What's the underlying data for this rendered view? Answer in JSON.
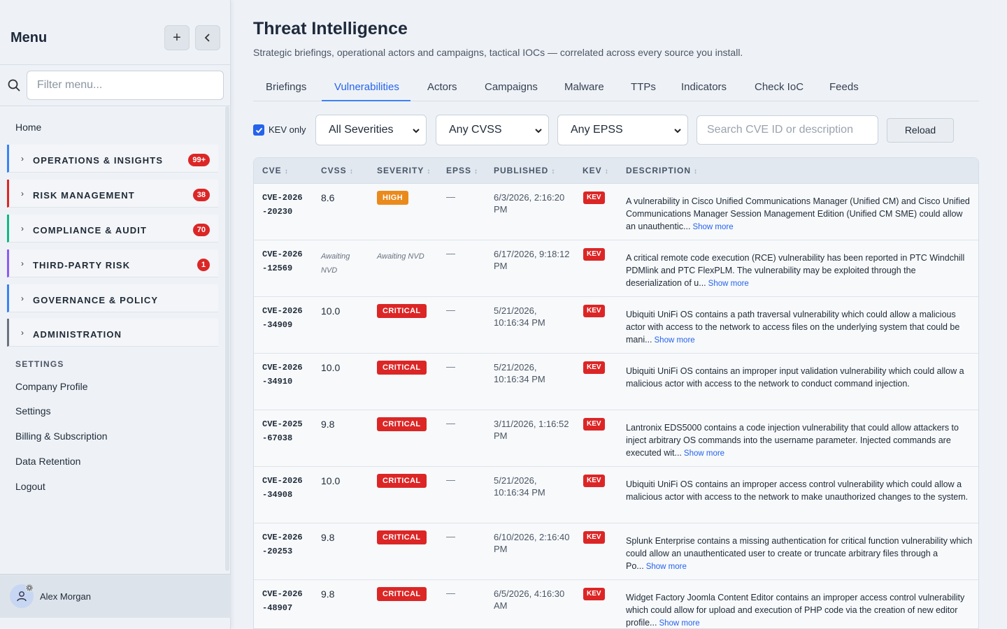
{
  "sidebar": {
    "title": "Menu",
    "filter_placeholder": "Filter menu...",
    "home": "Home",
    "groups": [
      {
        "label": "OPERATIONS & INSIGHTS",
        "badge": "99+",
        "color": "#3b82f6"
      },
      {
        "label": "RISK MANAGEMENT",
        "badge": "38",
        "color": "#dc2626"
      },
      {
        "label": "COMPLIANCE & AUDIT",
        "badge": "70",
        "color": "#10b981"
      },
      {
        "label": "THIRD-PARTY RISK",
        "badge": "1",
        "color": "#8b5cf6"
      },
      {
        "label": "GOVERNANCE & POLICY",
        "badge": "",
        "color": "#3b82f6"
      },
      {
        "label": "ADMINISTRATION",
        "badge": "",
        "color": "#6b7280"
      }
    ],
    "settings_header": "SETTINGS",
    "links": [
      "Company Profile",
      "Settings",
      "Billing & Subscription",
      "Data Retention",
      "Logout"
    ],
    "user_name": "Alex Morgan"
  },
  "main": {
    "title": "Threat Intelligence",
    "subtitle": "Strategic briefings, operational actors and campaigns, tactical IOCs — correlated across every source you install.",
    "tabs": [
      "Briefings",
      "Vulnerabilities",
      "Actors",
      "Campaigns",
      "Malware",
      "TTPs",
      "Indicators",
      "Check IoC",
      "Feeds"
    ],
    "active_tab": "Vulnerabilities"
  },
  "filters": {
    "kev_label": "KEV only",
    "severity": "All Severities",
    "cvss": "Any CVSS",
    "epss": "Any EPSS",
    "search_placeholder": "Search CVE ID or description",
    "reload": "Reload"
  },
  "table": {
    "headers": [
      "CVE",
      "CVSS",
      "SEVERITY",
      "EPSS",
      "PUBLISHED",
      "KEV",
      "DESCRIPTION"
    ],
    "show_more": "Show more",
    "rows": [
      {
        "cve": "CVE-2026-20230",
        "cvss": "8.6",
        "severity": "HIGH",
        "epss": "—",
        "published": "6/3/2026, 2:16:20 PM",
        "kev": "KEV",
        "desc": "A vulnerability in Cisco Unified Communications Manager (Unified CM) and Cisco Unified Communications Manager Session Management Edition (Unified CM SME) could allow an unauthentic...",
        "more": true
      },
      {
        "cve": "CVE-2026-12569",
        "cvss": "Awaiting NVD",
        "severity": "Awaiting NVD",
        "epss": "—",
        "published": "6/17/2026, 9:18:12 PM",
        "kev": "KEV",
        "desc": "A critical remote code execution (RCE) vulnerability has been reported in PTC Windchill PDMlink and PTC FlexPLM. The vulnerability may be exploited through the deserialization of u...",
        "more": true
      },
      {
        "cve": "CVE-2026-34909",
        "cvss": "10.0",
        "severity": "CRITICAL",
        "epss": "—",
        "published": "5/21/2026, 10:16:34 PM",
        "kev": "KEV",
        "desc": "Ubiquiti UniFi OS contains a path traversal vulnerability which could allow a malicious actor with access to the network to access files on the underlying system that could be mani...",
        "more": true
      },
      {
        "cve": "CVE-2026-34910",
        "cvss": "10.0",
        "severity": "CRITICAL",
        "epss": "—",
        "published": "5/21/2026, 10:16:34 PM",
        "kev": "KEV",
        "desc": "Ubiquiti UniFi OS contains an improper input validation vulnerability which could allow a malicious actor with access to the network to conduct command injection.",
        "more": false
      },
      {
        "cve": "CVE-2025-67038",
        "cvss": "9.8",
        "severity": "CRITICAL",
        "epss": "—",
        "published": "3/11/2026, 1:16:52 PM",
        "kev": "KEV",
        "desc": "Lantronix EDS5000 contains a code injection vulnerability that could allow attackers to inject arbitrary OS commands into the username parameter. Injected commands are executed wit...",
        "more": true
      },
      {
        "cve": "CVE-2026-34908",
        "cvss": "10.0",
        "severity": "CRITICAL",
        "epss": "—",
        "published": "5/21/2026, 10:16:34 PM",
        "kev": "KEV",
        "desc": "Ubiquiti UniFi OS contains an improper access control vulnerability which could allow a malicious actor with access to the network to make unauthorized changes to the system.",
        "more": false
      },
      {
        "cve": "CVE-2026-20253",
        "cvss": "9.8",
        "severity": "CRITICAL",
        "epss": "—",
        "published": "6/10/2026, 2:16:40 PM",
        "kev": "KEV",
        "desc": "Splunk Enterprise contains a missing authentication for critical function vulnerability which could allow an unauthenticated user to create or truncate arbitrary files through a Po...",
        "more": true
      },
      {
        "cve": "CVE-2026-48907",
        "cvss": "9.8",
        "severity": "CRITICAL",
        "epss": "—",
        "published": "6/5/2026, 4:16:30 AM",
        "kev": "KEV",
        "desc": "Widget Factory Joomla Content Editor contains an improper access control vulnerability which could allow for upload and execution of PHP code via the creation of new editor profile...",
        "more": true
      }
    ]
  }
}
